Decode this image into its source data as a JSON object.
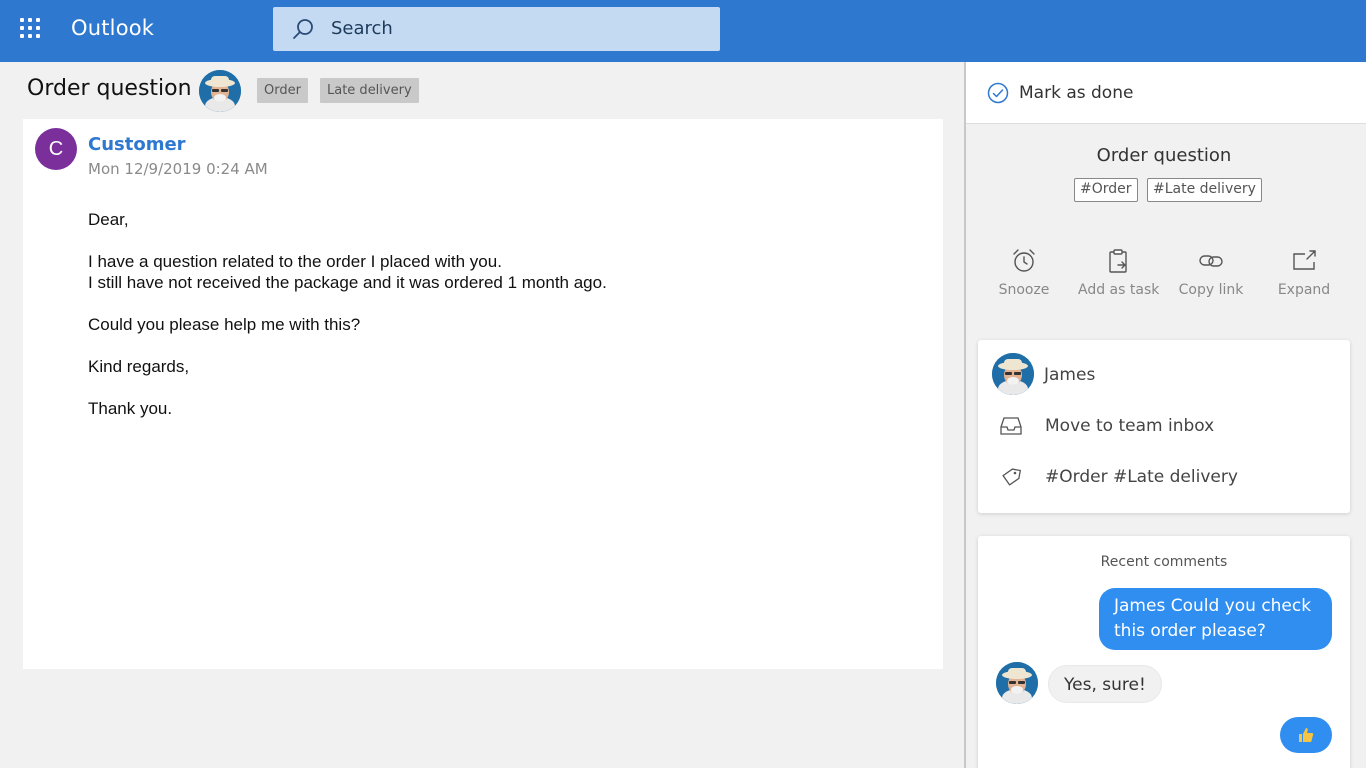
{
  "header": {
    "app_title": "Outlook",
    "search_placeholder": "Search",
    "accent_color": "#2f78d0"
  },
  "email": {
    "subject": "Order question",
    "tags": [
      "Order",
      "Late delivery"
    ],
    "sender_initial": "C",
    "sender_name": "Customer",
    "date": "Mon 12/9/2019 0:24 AM",
    "body": {
      "greeting": "Dear,",
      "line1": "I have a question related to the order I placed with you.",
      "line2": "I still have not received the package and it was ordered 1 month ago.",
      "line3": "Could you please help me with this?",
      "closing": "Kind regards,",
      "thanks": "Thank you."
    }
  },
  "panel": {
    "mark_done_label": "Mark as done",
    "subject": "Order question",
    "hashtags": [
      "#Order",
      "#Late delivery"
    ],
    "actions": [
      {
        "label": "Snooze",
        "icon": "alarm-clock-icon"
      },
      {
        "label": "Add as task",
        "icon": "clipboard-task-icon"
      },
      {
        "label": "Copy link",
        "icon": "link-icon"
      },
      {
        "label": "Expand",
        "icon": "expand-icon"
      }
    ],
    "assignee": "James",
    "move_label": "Move to team inbox",
    "tags_line": "#Order #Late delivery",
    "comments_title": "Recent comments",
    "comment_out": "James Could you check this order please?",
    "comment_in": "Yes, sure!",
    "reaction_icon": "thumbs-up-icon"
  }
}
